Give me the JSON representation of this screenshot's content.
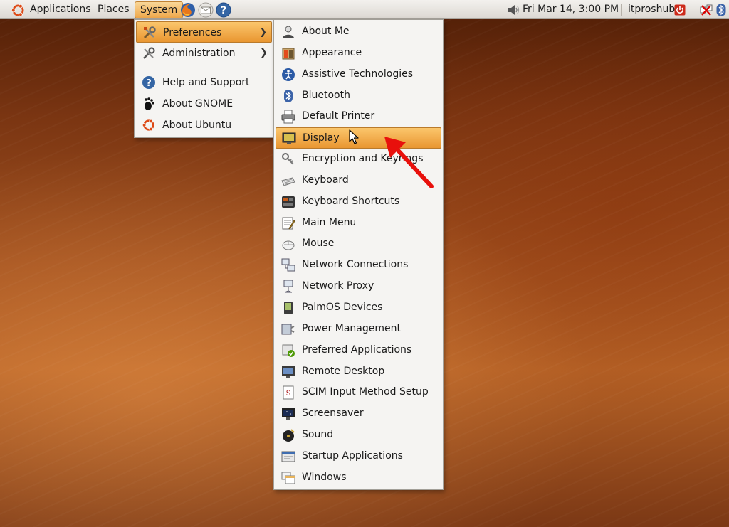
{
  "panel": {
    "applications_label": "Applications",
    "places_label": "Places",
    "system_label": "System",
    "clock": "Fri Mar 14,  3:00 PM",
    "user": "itproshub"
  },
  "system_menu": {
    "items": [
      {
        "label": "Preferences",
        "icon": "preferences-icon",
        "submenu": true,
        "active": true
      },
      {
        "label": "Administration",
        "icon": "administration-icon",
        "submenu": true
      },
      {
        "label": "Help and Support",
        "icon": "help-icon"
      },
      {
        "label": "About GNOME",
        "icon": "gnome-foot-icon"
      },
      {
        "label": "About Ubuntu",
        "icon": "ubuntu-icon"
      }
    ]
  },
  "preferences_menu": {
    "items": [
      {
        "label": "About Me",
        "icon": "user-icon"
      },
      {
        "label": "Appearance",
        "icon": "appearance-icon"
      },
      {
        "label": "Assistive Technologies",
        "icon": "accessibility-icon"
      },
      {
        "label": "Bluetooth",
        "icon": "bluetooth-icon"
      },
      {
        "label": "Default Printer",
        "icon": "printer-icon"
      },
      {
        "label": "Display",
        "icon": "display-icon",
        "active": true
      },
      {
        "label": "Encryption and Keyrings",
        "icon": "keyring-icon"
      },
      {
        "label": "Keyboard",
        "icon": "keyboard-icon"
      },
      {
        "label": "Keyboard Shortcuts",
        "icon": "keyboard-shortcuts-icon"
      },
      {
        "label": "Main Menu",
        "icon": "main-menu-icon"
      },
      {
        "label": "Mouse",
        "icon": "mouse-icon"
      },
      {
        "label": "Network Connections",
        "icon": "network-connections-icon"
      },
      {
        "label": "Network Proxy",
        "icon": "network-proxy-icon"
      },
      {
        "label": "PalmOS Devices",
        "icon": "palm-device-icon"
      },
      {
        "label": "Power Management",
        "icon": "power-management-icon"
      },
      {
        "label": "Preferred Applications",
        "icon": "preferred-apps-icon"
      },
      {
        "label": "Remote Desktop",
        "icon": "remote-desktop-icon"
      },
      {
        "label": "SCIM Input Method Setup",
        "icon": "scim-icon"
      },
      {
        "label": "Screensaver",
        "icon": "screensaver-icon"
      },
      {
        "label": "Sound",
        "icon": "sound-icon"
      },
      {
        "label": "Startup Applications",
        "icon": "startup-icon"
      },
      {
        "label": "Windows",
        "icon": "windows-icon"
      }
    ]
  },
  "colors": {
    "highlight": "#efa84c",
    "annotation_arrow": "#e8100c"
  }
}
